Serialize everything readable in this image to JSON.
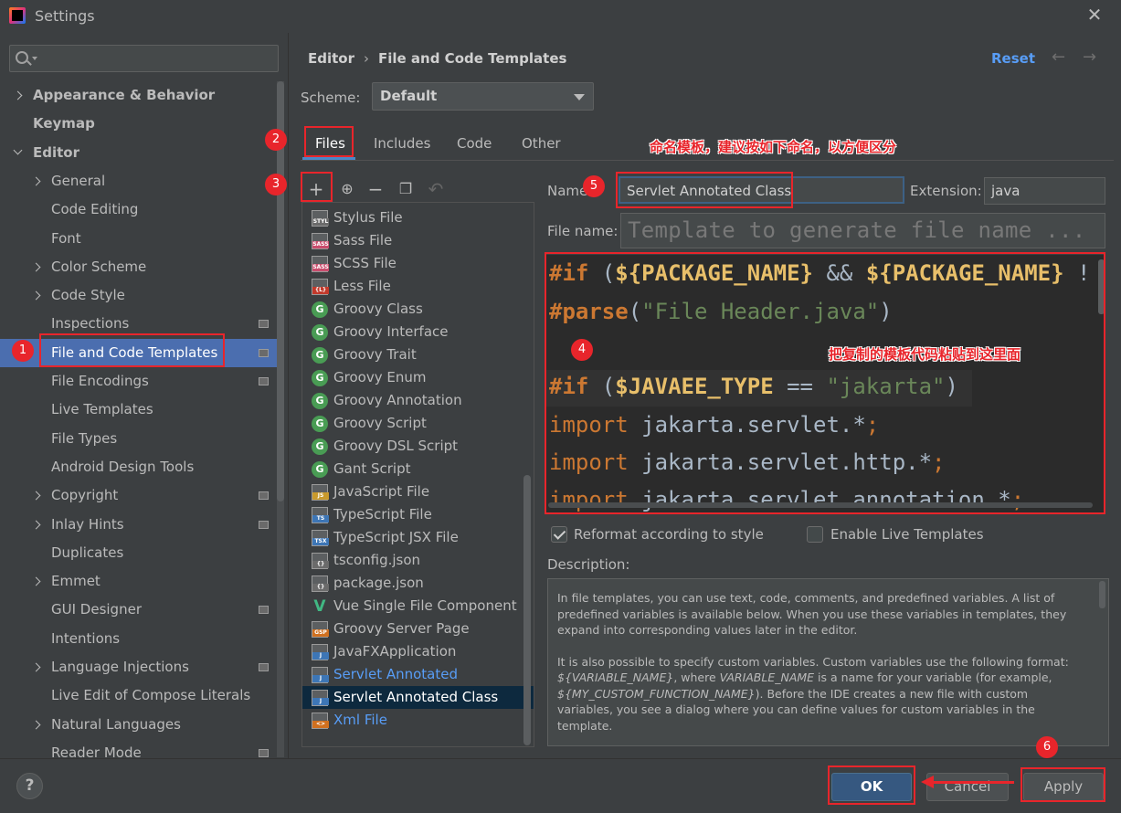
{
  "window": {
    "title": "Settings"
  },
  "search": {
    "placeholder": ""
  },
  "sidebar": {
    "items": [
      {
        "label": "Appearance & Behavior",
        "expander": "right",
        "indent": 0,
        "bold": true
      },
      {
        "label": "Keymap",
        "expander": "",
        "indent": 0,
        "bold": true
      },
      {
        "label": "Editor",
        "expander": "down",
        "indent": 0,
        "bold": true
      },
      {
        "label": "General",
        "expander": "right",
        "indent": 1
      },
      {
        "label": "Code Editing",
        "expander": "",
        "indent": 1
      },
      {
        "label": "Font",
        "expander": "",
        "indent": 1
      },
      {
        "label": "Color Scheme",
        "expander": "right",
        "indent": 1
      },
      {
        "label": "Code Style",
        "expander": "right",
        "indent": 1
      },
      {
        "label": "Inspections",
        "expander": "",
        "indent": 1,
        "badge": true
      },
      {
        "label": "File and Code Templates",
        "expander": "",
        "indent": 1,
        "badge": true,
        "selected": true
      },
      {
        "label": "File Encodings",
        "expander": "",
        "indent": 1,
        "badge": true
      },
      {
        "label": "Live Templates",
        "expander": "",
        "indent": 1
      },
      {
        "label": "File Types",
        "expander": "",
        "indent": 1
      },
      {
        "label": "Android Design Tools",
        "expander": "",
        "indent": 1
      },
      {
        "label": "Copyright",
        "expander": "right",
        "indent": 1,
        "badge": true
      },
      {
        "label": "Inlay Hints",
        "expander": "right",
        "indent": 1,
        "badge": true
      },
      {
        "label": "Duplicates",
        "expander": "",
        "indent": 1
      },
      {
        "label": "Emmet",
        "expander": "right",
        "indent": 1
      },
      {
        "label": "GUI Designer",
        "expander": "",
        "indent": 1,
        "badge": true
      },
      {
        "label": "Intentions",
        "expander": "",
        "indent": 1
      },
      {
        "label": "Language Injections",
        "expander": "right",
        "indent": 1,
        "badge": true
      },
      {
        "label": "Live Edit of Compose Literals",
        "expander": "",
        "indent": 1
      },
      {
        "label": "Natural Languages",
        "expander": "right",
        "indent": 1
      },
      {
        "label": "Reader Mode",
        "expander": "",
        "indent": 1,
        "badge": true
      }
    ]
  },
  "breadcrumb": {
    "part1": "Editor",
    "sep": "›",
    "part2": "File and Code Templates"
  },
  "header": {
    "reset": "Reset",
    "back": "←",
    "forward": "→"
  },
  "scheme": {
    "label": "Scheme:",
    "value": "Default"
  },
  "tabs": [
    "Files",
    "Includes",
    "Code",
    "Other"
  ],
  "toolbar": {
    "add": "+",
    "add_child": "⊕",
    "remove": "−",
    "copy": "❐",
    "revert": "↶"
  },
  "templates": [
    {
      "label": "Stylus File",
      "icon": "doc",
      "tag": "STYL",
      "tagColor": "#6b6b6b"
    },
    {
      "label": "Sass File",
      "icon": "doc",
      "tag": "SASS",
      "tagColor": "#c94d6d"
    },
    {
      "label": "SCSS File",
      "icon": "doc",
      "tag": "SASS",
      "tagColor": "#c94d6d"
    },
    {
      "label": "Less File",
      "icon": "doc",
      "tag": "{L}",
      "tagColor": "#c2392b"
    },
    {
      "label": "Groovy Class",
      "icon": "circle",
      "tag": "G"
    },
    {
      "label": "Groovy Interface",
      "icon": "circle",
      "tag": "G"
    },
    {
      "label": "Groovy Trait",
      "icon": "circle",
      "tag": "G"
    },
    {
      "label": "Groovy Enum",
      "icon": "circle",
      "tag": "G"
    },
    {
      "label": "Groovy Annotation",
      "icon": "circle",
      "tag": "G"
    },
    {
      "label": "Groovy Script",
      "icon": "circle",
      "tag": "G"
    },
    {
      "label": "Groovy DSL Script",
      "icon": "circle",
      "tag": "G"
    },
    {
      "label": "Gant Script",
      "icon": "circle",
      "tag": "G"
    },
    {
      "label": "JavaScript File",
      "icon": "doc",
      "tag": "JS",
      "tagColor": "#c99a2c"
    },
    {
      "label": "TypeScript File",
      "icon": "doc",
      "tag": "TS",
      "tagColor": "#3d76b6"
    },
    {
      "label": "TypeScript JSX File",
      "icon": "doc",
      "tag": "TSX",
      "tagColor": "#3d76b6"
    },
    {
      "label": "tsconfig.json",
      "icon": "doc",
      "tag": "{}",
      "tagColor": "#6b6b6b"
    },
    {
      "label": "package.json",
      "icon": "doc",
      "tag": "{}",
      "tagColor": "#6b6b6b"
    },
    {
      "label": "Vue Single File Component",
      "icon": "vue",
      "tag": "V"
    },
    {
      "label": "Groovy Server Page",
      "icon": "doc",
      "tag": "GSP",
      "tagColor": "#d0701f"
    },
    {
      "label": "JavaFXApplication",
      "icon": "doc",
      "tag": "J",
      "tagColor": "#3d76b6"
    },
    {
      "label": "Servlet Annotated",
      "icon": "doc",
      "tag": "J",
      "tagColor": "#3d76b6",
      "blue": true
    },
    {
      "label": "Servlet Annotated Class",
      "icon": "doc",
      "tag": "J",
      "tagColor": "#3d76b6",
      "selected": true
    },
    {
      "label": "Xml File",
      "icon": "doc",
      "tag": "<>",
      "tagColor": "#d0701f",
      "blue": true
    }
  ],
  "form": {
    "name_label": "Name:",
    "name_value": "Servlet Annotated Class",
    "ext_label": "Extension:",
    "ext_value": "java",
    "filename_label": "File name:",
    "filename_placeholder": "Template to generate file name ..."
  },
  "code": {
    "line1_dir": "#if",
    "line1_open": " (",
    "line1_var1": "${PACKAGE_NAME}",
    "line1_and": " && ",
    "line1_var2": "${PACKAGE_NAME}",
    "line1_tail": " !",
    "line2_dir": "#parse",
    "line2_open": "(",
    "line2_str": "\"File Header.java\"",
    "line2_close": ")",
    "line4_dir": "#if",
    "line4_open": " (",
    "line4_var": "$JAVAEE_TYPE",
    "line4_eq": " == ",
    "line4_str": "\"jakarta\"",
    "line4_close": ")",
    "import_kw": "import",
    "imp1": " jakarta.servlet.*",
    "imp2": " jakarta.servlet.http.*",
    "imp3": " jakarta.servlet.annotation.*",
    "semi": ";"
  },
  "options": {
    "reformat": "Reformat according to style",
    "live_templates": "Enable Live Templates"
  },
  "description": {
    "label": "Description:",
    "p1": "In file templates, you can use text, code, comments, and predefined variables. A list of predefined variables is available below. When you use these variables in templates, they expand into corresponding values later in the editor.",
    "p2a": "It is also possible to specify custom variables. Custom variables use the following format: ",
    "p2v1": "${VARIABLE_NAME}",
    "p2b": ", where ",
    "p2v2": "VARIABLE_NAME",
    "p2c": " is a name for your variable (for example, ",
    "p2v3": "${MY_CUSTOM_FUNCTION_NAME}",
    "p2d": "). Before the IDE creates a new file with custom variables, you see a dialog where you can define values for custom variables in the template."
  },
  "buttons": {
    "help": "?",
    "ok": "OK",
    "cancel": "Cancel",
    "apply": "Apply"
  },
  "annotations": {
    "b1": "1",
    "b2": "2",
    "b3": "3",
    "b4": "4",
    "b5": "5",
    "b6": "6",
    "naming_note": "命名模板，建议按如下命名，以方便区分",
    "paste_note": "把复制的模板代码粘贴到这里面"
  },
  "colors": {
    "accent": "#4b6eaf",
    "link": "#589df6",
    "annotation": "#e8252b"
  }
}
